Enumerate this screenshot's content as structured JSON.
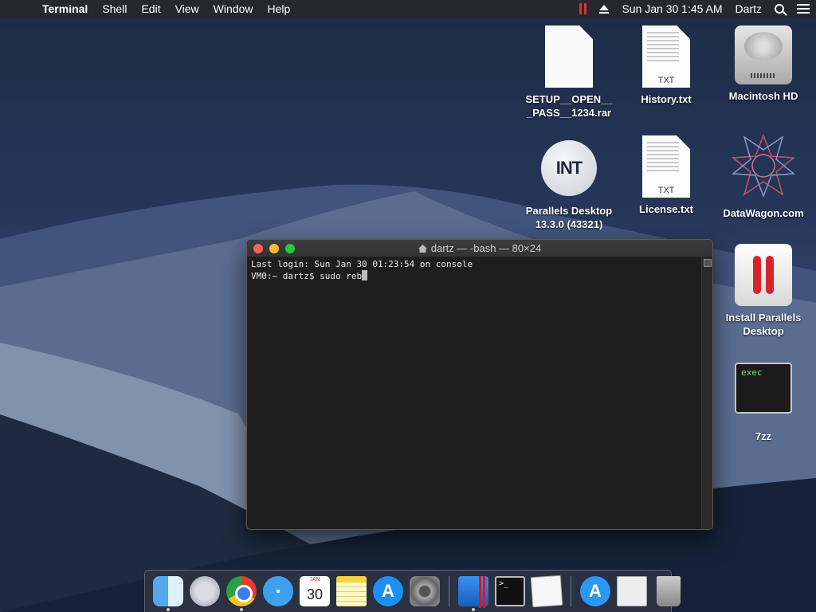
{
  "menubar": {
    "app_name": "Terminal",
    "menus": [
      "Shell",
      "Edit",
      "View",
      "Window",
      "Help"
    ],
    "clock": "Sun Jan 30  1:45 AM",
    "user": "Dartz"
  },
  "desktop_icons": [
    {
      "label": "SETUP__OPEN__\n_PASS__1234.rar",
      "icon": "blank-document-icon"
    },
    {
      "label": "History.txt",
      "icon": "text-document-icon",
      "tag": "TXT"
    },
    {
      "label": "Macintosh HD",
      "icon": "hard-drive-icon"
    },
    {
      "label": "Parallels Desktop\n13.3.0 (43321)",
      "icon": "parallels-desktop-app-icon",
      "glyph": "INT"
    },
    {
      "label": "License.txt",
      "icon": "text-document-icon",
      "tag": "TXT"
    },
    {
      "label": "DataWagon.com",
      "icon": "star-pattern-icon"
    },
    {
      "label": "Install Parallels\nDesktop",
      "icon": "install-parallels-icon"
    },
    {
      "label": "7zz",
      "icon": "exec-icon",
      "glyph": "exec"
    }
  ],
  "terminal": {
    "title": "dartz — -bash — 80×24",
    "lines": [
      "Last login: Sun Jan 30 01:23:54 on console",
      "VM0:~ dartz$ sudo reb"
    ]
  },
  "dock": {
    "calendar_month": "JAN",
    "calendar_day": "30",
    "terminal_glyph": ">_",
    "appstore_glyph": "A",
    "items": [
      "Finder",
      "Launchpad",
      "Google Chrome",
      "Safari",
      "Calendar",
      "Notes",
      "App Store",
      "System Preferences",
      "Parallels Desktop",
      "Terminal",
      "TextEdit",
      "App Store",
      "Document",
      "Trash"
    ]
  }
}
